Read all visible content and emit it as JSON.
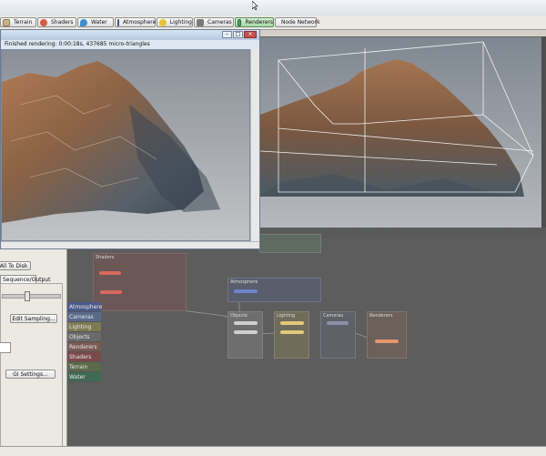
{
  "toolbar": {
    "tabs": [
      {
        "label": "Terrain",
        "icon": "terrain-icon",
        "color": "#c9b48a"
      },
      {
        "label": "Shaders",
        "icon": "shaders-icon",
        "color": "#d25a4a"
      },
      {
        "label": "Water",
        "icon": "water-icon",
        "color": "#3f8fd0"
      },
      {
        "label": "Atmosphere",
        "icon": "atmosphere-icon",
        "color": "#6a8ad0"
      },
      {
        "label": "Lighting",
        "icon": "lighting-icon",
        "color": "#e8c23a"
      },
      {
        "label": "Cameras",
        "icon": "cameras-icon",
        "color": "#7a7a7a"
      },
      {
        "label": "Renderers",
        "icon": "renderers-icon",
        "color": "#4aa05a",
        "active": true
      },
      {
        "label": "Node Network",
        "icon": "node-network-icon",
        "color": "#555555"
      }
    ]
  },
  "render_window": {
    "status": "Finished rendering: 0:00:18s, 437685 micro-triangles"
  },
  "left_panel": {
    "save_button": "All To Disk",
    "sequence_tab": "Sequence/Output",
    "edit_sampling_button": "Edit Sampling...",
    "gi_settings_button": "GI Settings..."
  },
  "node_network": {
    "groups": {
      "shaders": "Shaders",
      "atmosphere": "Atmosphere",
      "objects": "Objects",
      "lighting": "Lighting",
      "cameras": "Cameras",
      "renderers": "Renderers"
    },
    "legend": [
      {
        "label": "Atmosphere",
        "color": "#4a5a8a"
      },
      {
        "label": "Cameras",
        "color": "#5a6a8a"
      },
      {
        "label": "Lighting",
        "color": "#7c7a52"
      },
      {
        "label": "Objects",
        "color": "#6a6a6a"
      },
      {
        "label": "Renderers",
        "color": "#7a5a52"
      },
      {
        "label": "Shaders",
        "color": "#7a4a4a"
      },
      {
        "label": "Terrain",
        "color": "#5a6a4a"
      },
      {
        "label": "Water",
        "color": "#3f6a55"
      }
    ]
  },
  "colors": {
    "active_tab": "#a9d8a9",
    "node_bg": "#5d5d5d",
    "shader_pill": "#d9685e",
    "atmosphere_pill": "#6e83c9",
    "object_pill": "#cfcfcf",
    "lighting_pill": "#e3c879",
    "renderer_pill": "#e3956e"
  }
}
